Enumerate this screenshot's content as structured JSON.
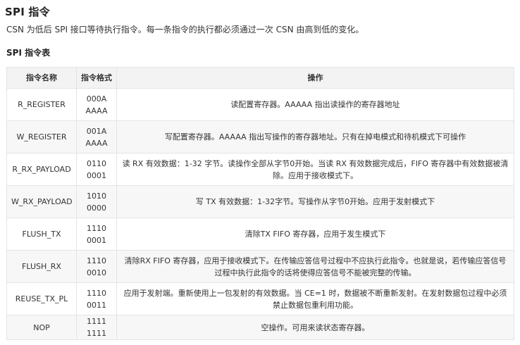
{
  "section_title": "SPI 指令",
  "description": "CSN 为低后 SPI 接口等待执行指令。每一条指令的执行都必须通过一次 CSN 由高到低的变化。",
  "table_title": "SPI 指令表",
  "table": {
    "headers": [
      "指令名称",
      "指令格式",
      "操作"
    ],
    "rows": [
      {
        "name": "R_REGISTER",
        "format": "000A\nAAAA",
        "operation": "读配置寄存器。AAAAA 指出读操作的寄存器地址"
      },
      {
        "name": "W_REGISTER",
        "format": "001A\nAAAA",
        "operation": "写配置寄存器。AAAAA 指出写操作的寄存器地址。只有在掉电模式和待机模式下可操作"
      },
      {
        "name": "R_RX_PAYLOAD",
        "format": "0110\n0001",
        "operation": "读 RX 有效数据：1-32 字节。读操作全部从字节0开始。当读 RX 有效数据完成后，FIFO 寄存器中有效数据被清除。应用于接收模式下。"
      },
      {
        "name": "W_RX_PAYLOAD",
        "format": "1010\n0000",
        "operation": "写 TX 有效数据：1-32字节。写操作从字节0开始。应用于发射模式下"
      },
      {
        "name": "FLUSH_TX",
        "format": "1110\n0001",
        "operation": "清除TX FIFO 寄存器，应用于发生模式下"
      },
      {
        "name": "FLUSH_RX",
        "format": "1110\n0010",
        "operation": "清除RX FIFO 寄存器，应用于接收模式下。在传输应答信号过程中不应执行此指令。也就是说，若传输应答信号过程中执行此指令的话将使得应答信号不能被完整的传输。"
      },
      {
        "name": "REUSE_TX_PL",
        "format": "1110\n0011",
        "operation": "应用于发射端。重新使用上一包发射的有效数据。当 CE=1 时，数据被不断重新发射。在发射数据包过程中必须禁止数据包重利用功能。"
      },
      {
        "name": "NOP",
        "format": "1111 1111",
        "operation": "空操作。可用来读状态寄存器。"
      }
    ]
  }
}
